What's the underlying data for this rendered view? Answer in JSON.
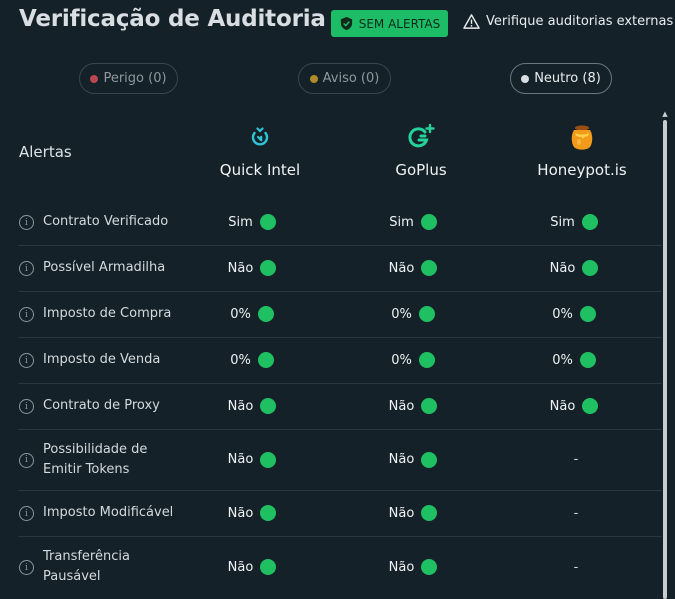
{
  "header": {
    "title": "Verificação de Auditoria",
    "badge_label": "SEM ALERTAS",
    "external_label": "Verifique auditorias externas"
  },
  "filters": [
    {
      "label": "Perigo (0)",
      "color": "#b8474f"
    },
    {
      "label": "Aviso (0)",
      "color": "#b08b2b"
    },
    {
      "label": "Neutro (8)",
      "color": "#d9dee2"
    }
  ],
  "table": {
    "alerts_label": "Alertas",
    "providers": [
      {
        "name": "Quick Intel",
        "icon": "quick-intel-logo"
      },
      {
        "name": "GoPlus",
        "icon": "goplus-logo"
      },
      {
        "name": "Honeypot.is",
        "icon": "honeypot-logo"
      }
    ],
    "rows": [
      {
        "label": "Contrato Verificado",
        "values": [
          "Sim",
          "Sim",
          "Sim"
        ]
      },
      {
        "label": "Possível Armadilha",
        "values": [
          "Não",
          "Não",
          "Não"
        ]
      },
      {
        "label": "Imposto de Compra",
        "values": [
          "0%",
          "0%",
          "0%"
        ]
      },
      {
        "label": "Imposto de Venda",
        "values": [
          "0%",
          "0%",
          "0%"
        ]
      },
      {
        "label": "Contrato de Proxy",
        "values": [
          "Não",
          "Não",
          "Não"
        ]
      },
      {
        "label": "Possibilidade de Emitir Tokens",
        "values": [
          "Não",
          "Não",
          "-"
        ]
      },
      {
        "label": "Imposto Modificável",
        "values": [
          "Não",
          "Não",
          "-"
        ]
      },
      {
        "label": "Transferência Pausável",
        "values": [
          "Não",
          "Não",
          "-"
        ]
      }
    ]
  },
  "colors": {
    "background": "#152128",
    "success": "#1fc062",
    "badge": "#1dbc66"
  }
}
